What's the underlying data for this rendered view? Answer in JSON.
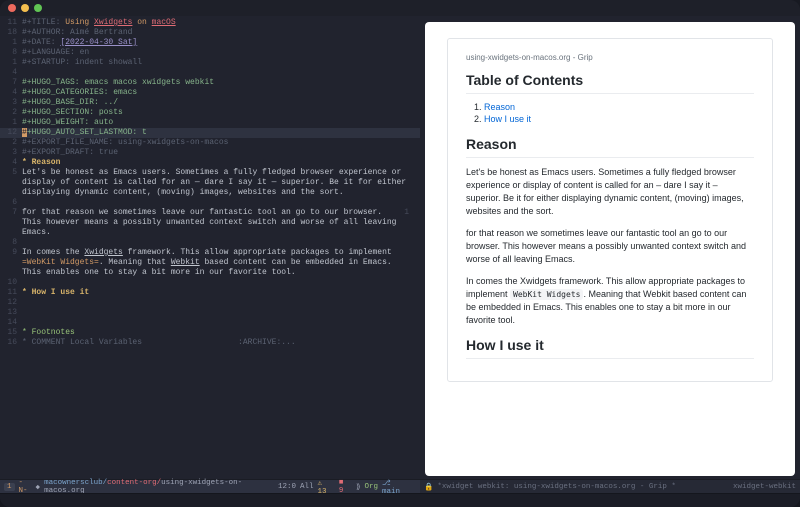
{
  "header": {
    "lines": [
      {
        "n": "11",
        "prefix": "#+TITLE: ",
        "segs": [
          [
            "Using ",
            "orange"
          ],
          [
            "Xwidgets",
            "red2 ul"
          ],
          [
            " on ",
            "orange"
          ],
          [
            "macOS",
            "red2 ul"
          ]
        ]
      },
      {
        "n": "18",
        "prefix": "#+AUTHOR: ",
        "val": "Aimé Bertrand",
        "cls": "kwd"
      },
      {
        "n": "1",
        "prefix": "#+DATE: ",
        "segs": [
          [
            "[2022-04-30 Sat]",
            "purp ul"
          ]
        ]
      },
      {
        "n": "8",
        "prefix": "#+LANGUAGE: ",
        "val": "en",
        "cls": "kwd"
      },
      {
        "n": "1",
        "prefix": "#+STARTUP: ",
        "val": "indent showall",
        "cls": "kwd"
      },
      {
        "n": "4",
        "prefix": "",
        "val": "",
        "cls": "kwd"
      },
      {
        "n": "7",
        "prefix": "#+HUGO_TAGS: ",
        "val": "emacs macos xwidgets webkit",
        "cls": "kwdg"
      },
      {
        "n": "4",
        "prefix": "#+HUGO_CATEGORIES: ",
        "val": "emacs",
        "cls": "kwdg"
      },
      {
        "n": "3",
        "prefix": "#+HUGO_BASE_DIR: ",
        "val": "../",
        "cls": "kwdg"
      },
      {
        "n": "2",
        "prefix": "#+HUGO_SECTION: ",
        "val": "posts",
        "cls": "kwdg"
      },
      {
        "n": "1",
        "prefix": "#+HUGO_WEIGHT: ",
        "val": "auto",
        "cls": "kwdg"
      },
      {
        "n": "12",
        "prefix": "#+HUGO_AUTO_SET_LASTMOD: ",
        "val": "t",
        "cls": "kwdg",
        "current": true,
        "curchar": "#"
      },
      {
        "n": "2",
        "prefix": "#+EXPORT_FILE_NAME: ",
        "val": "using-xwidgets-on-macos",
        "cls": "kwd"
      },
      {
        "n": "3",
        "prefix": "#+EXPORT_DRAFT: ",
        "val": "true",
        "cls": "kwd"
      }
    ],
    "blank2": "",
    "h_reason_n": "4",
    "h_reason": "* Reason",
    "p1_n": "5",
    "p1": "Let's be honest as Emacs users. Sometimes a fully fledged browser experience or display of content is called for an — dare I say it — superior. Be it for either displaying dynamic content, (moving) images, websites and the sort.",
    "blank3_n": "6",
    "p2_n": "7",
    "p2": "for that reason we sometimes leave our fantastic tool an go to our browser. This however means a possibly unwanted context switch and worse of all leaving Emacs.",
    "blank4_n": "8",
    "p3_n": "9",
    "p3_pre": "In comes the ",
    "p3_link": "Xwidgets",
    "p3_mid": " framework. This allow appropriate packages to implement ",
    "p3_eq": "=WebKit Widgets=",
    "p3_post": ". Meaning that ",
    "p3_u2": "Webkit",
    "p3_tail": " based content can be embedded in Emacs. This enables one to stay a bit more in our favorite tool.",
    "blank5_n": "10",
    "h_use_n": "11",
    "h_use": "* How I use it",
    "gap_nums": [
      "12",
      "13",
      "14"
    ],
    "foot_n": "15",
    "foot": "* Footnotes",
    "comment_n": "16",
    "comment": "* COMMENT Local Variables",
    "archive": ":ARCHIVE:..."
  },
  "modeline_left": {
    "num": "1",
    "mode": "-N-",
    "path1": "macownersclub/",
    "path2": "content-org/",
    "file": "using-xwidgets-on-macos.org",
    "pos": "12:0",
    "all": "All",
    "warn": "13",
    "err": "9",
    "major": "Org",
    "git": "main"
  },
  "modeline_right": {
    "title": "*xwidget webkit: using-xwidgets-on-macos.org - Grip *",
    "mode": "xwidget-webkit"
  },
  "preview": {
    "tab": "using-xwidgets-on-macos.org - Grip",
    "toc": "Table of Contents",
    "toc_items": [
      "Reason",
      "How I use it"
    ],
    "h_reason": "Reason",
    "p1": "Let's be honest as Emacs users. Sometimes a fully fledged browser experience or display of content is called for an – dare I say it – superior. Be it for either displaying dynamic content, (moving) images, websites and the sort.",
    "p2": "for that reason we sometimes leave our fantastic tool an go to our browser. This however means a possibly unwanted context switch and worse of all leaving Emacs.",
    "p3a": "In comes the Xwidgets framework. This allow appropriate packages to implement ",
    "p3code": "WebKit Widgets",
    "p3b": ". Meaning that Webkit based content can be embedded in Emacs. This enables one to stay a bit more in our favorite tool.",
    "h_use": "How I use it"
  },
  "side_gutter_right": "1"
}
